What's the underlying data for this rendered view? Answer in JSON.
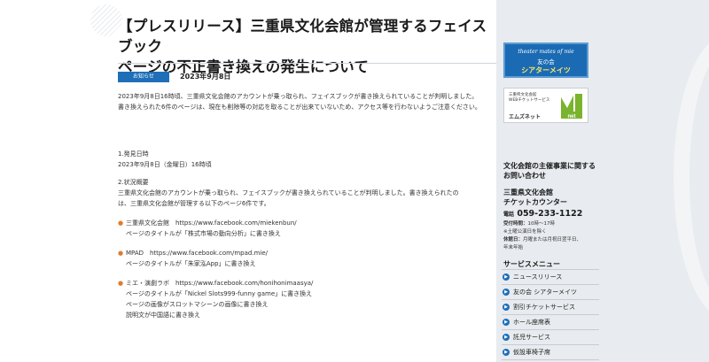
{
  "article": {
    "title_lines": [
      "【プレスリリース】三重県文化会館が管理するフェイスブック",
      "ページの不正書き換えの発生について"
    ],
    "badge": "お知らせ",
    "date": "2023年9月8日",
    "intro": "2023年9月8日16時頃、三重県文化会館のアカウントが乗っ取られ、フェイスブックが書き換えられていることが判明しました。\n書き換えられた6件のページは、現在も削除等の対応を取ることが出来ていないため、アクセス等を行わないようご注意ください。",
    "section1_heading": "1.発見日時",
    "section1_text": "2023年9月8日（金曜日）16時頃",
    "section2_heading": "2.状況概要",
    "section2_text": "三重県文化会館のアカウントが乗っ取られ、フェイスブックが書き換えられていることが判明しました。書き換えられたの\nは、三重県文化会館が管理する以下のページ6件です。",
    "items": [
      "三重県文化会館　https://www.facebook.com/miekenbun/\nページのタイトルが「株式市場の動向分析」に書き換え",
      "MPAD　https://www.facebook.com/mpad.mie/\nページのタイトルが「朱家泓App」に書き換え",
      "ミエ・演劇ラボ　https://www.facebook.com/honihonimaasya/\nページのタイトルが「Nickel Slots999-funny game」に書き換え\nページの画像がスロットマシーンの画像に書き換え\n説明文が中国語に書き換え"
    ]
  },
  "sidebar": {
    "banner1": {
      "line1": "theater mates of mie",
      "line2": "友の会",
      "line3": "シアターメイツ"
    },
    "banner2": {
      "line1": "三重県文化会館",
      "line2": "WEBチケットサービス",
      "line3": "エムズネット",
      "logo_text": "net"
    },
    "inquiry_title": "文化会館の主催事業に関するお問い合わせ",
    "office_line1": "三重県文化会館",
    "office_line2": "チケットカウンター",
    "phone_label": "電話",
    "phone": "059-233-1122",
    "hours_label": "受付時間：",
    "hours": "10時〜17時",
    "hours_note": "※土曜公演日を除く",
    "closed_label": "休館日：",
    "closed": "月曜または月祝日翌平日、",
    "closed2": "年末年始",
    "menu_title": "サービスメニュー",
    "menu": [
      "ニュースリリース",
      "友の会 シアターメイツ",
      "割引チケットサービス",
      "ホール座席表",
      "託児サービス",
      "仮設車椅子席"
    ],
    "accent": "#1e6fb8"
  }
}
